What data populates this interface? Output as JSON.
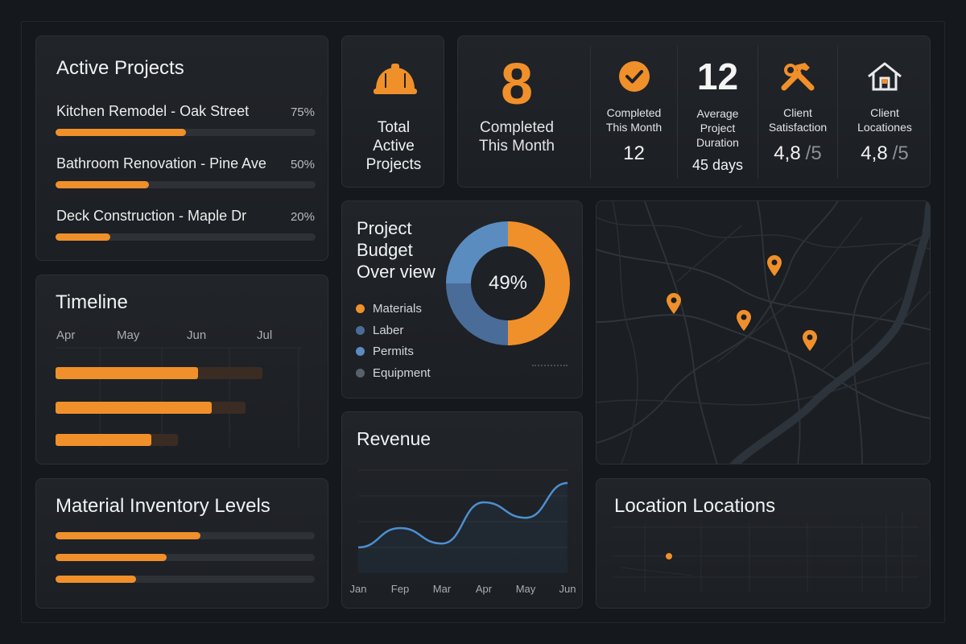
{
  "active_projects": {
    "title": "Active Projects",
    "items": [
      {
        "name": "Kitchen Remodel - Oak Street",
        "percent_label": "75%",
        "progress": 0.5
      },
      {
        "name": "Bathroom Renovation - Pine Ave",
        "percent_label": "50%",
        "progress": 0.36
      },
      {
        "name": "Deck Construction - Maple Dr",
        "percent_label": "20%",
        "progress": 0.21
      }
    ]
  },
  "timeline": {
    "title": "Timeline",
    "months": [
      "Apr",
      "May",
      "Jun",
      "Jul"
    ],
    "bars": [
      {
        "progress": 0.69
      },
      {
        "progress": 0.82
      },
      {
        "progress": 0.78
      }
    ]
  },
  "inventory": {
    "title": "Material Inventory Levels",
    "levels": [
      0.56,
      0.43,
      0.31
    ]
  },
  "total_active": {
    "icon": "hard-hat-icon",
    "label_line1": "Total",
    "label_line2": "Active",
    "label_line3": "Projects"
  },
  "completed": {
    "value": "8",
    "label_line1": "Completed",
    "label_line2": "This Month"
  },
  "kpis": [
    {
      "icon": "checkmark-circle-icon",
      "big": "",
      "label_line1": "Completed",
      "label_line2": "This Month",
      "label_line3": "",
      "value": "12",
      "suffix": ""
    },
    {
      "icon": "",
      "big": "12",
      "label_line1": "Average",
      "label_line2": "Project",
      "label_line3": "Duration",
      "value": "45 days",
      "suffix": ""
    },
    {
      "icon": "tools-icon",
      "big": "",
      "label_line1": "Client",
      "label_line2": "Satisfaction",
      "label_line3": "",
      "value": "4,8",
      "suffix": "/5"
    },
    {
      "icon": "house-icon",
      "big": "",
      "label_line1": "Client",
      "label_line2": "Locationes",
      "label_line3": "",
      "value": "4,8",
      "suffix": "/5"
    }
  ],
  "budget": {
    "title_line1": "Project",
    "title_line2": "Budget",
    "title_line3": "Over view",
    "center_label": "49%",
    "legend": [
      {
        "label": "Materials",
        "color": "#f0902a"
      },
      {
        "label": "Laber",
        "color": "#4a6c98"
      },
      {
        "label": "Permits",
        "color": "#5b8cc0"
      },
      {
        "label": "Equipment",
        "color": "#59606a"
      }
    ],
    "slices": [
      {
        "label": "Materials",
        "value": 50,
        "color": "#f0902a"
      },
      {
        "label": "Laber",
        "value": 25,
        "color": "#4a6c98"
      },
      {
        "label": "Permits",
        "value": 25,
        "color": "#5b8cc0"
      }
    ]
  },
  "revenue": {
    "title": "Revenue",
    "chart_data": {
      "type": "line",
      "x": [
        "Jan",
        "Fep",
        "Mar",
        "Apr",
        "May",
        "Jun"
      ],
      "series": [
        {
          "values": [
            2.0,
            3.5,
            2.3,
            5.5,
            4.3,
            7.0
          ],
          "color": "#4d8fd0"
        }
      ],
      "ylim": [
        0,
        8
      ],
      "grid": true
    }
  },
  "map": {
    "pins": 4,
    "pin_color": "#f0902a"
  },
  "locations": {
    "title": "Location Locations"
  },
  "colors": {
    "accent": "#f0902a",
    "background": "#15181c",
    "card": "#202328"
  }
}
